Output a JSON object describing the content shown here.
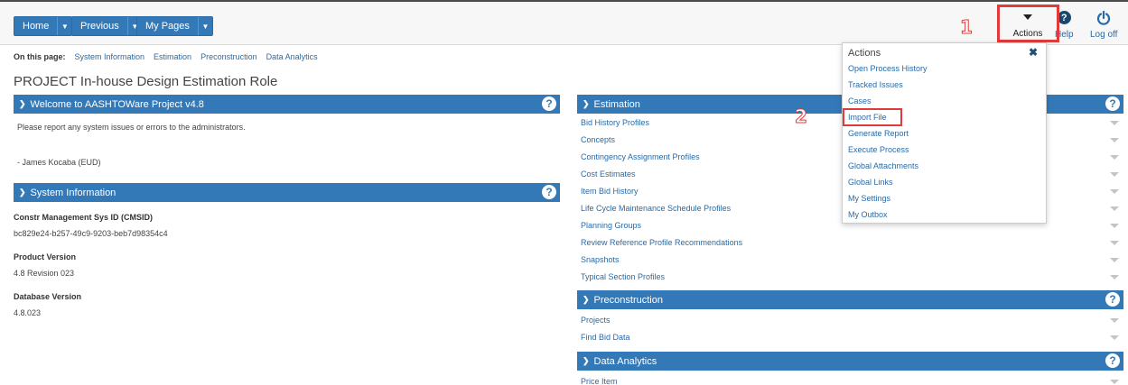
{
  "nav": {
    "home": "Home",
    "previous": "Previous",
    "my_pages": "My Pages"
  },
  "toolbar": {
    "actions": "Actions",
    "help": "Help",
    "logoff": "Log off"
  },
  "steps": {
    "one": "1",
    "two": "2"
  },
  "on_this_page": {
    "lead": "On this page:",
    "links": [
      "System Information",
      "Estimation",
      "Preconstruction",
      "Data Analytics"
    ]
  },
  "page_title": "PROJECT In-house Design Estimation Role",
  "welcome": {
    "title": "Welcome to AASHTOWare Project v4.8",
    "message": "Please report any system issues or errors to the administrators.",
    "signature": "- James Kocaba (EUD)"
  },
  "system_info": {
    "title": "System Information",
    "cmsid_label": "Constr Management Sys ID (CMSID)",
    "cmsid_value": "bc829e24-b257-49c9-9203-beb7d98354c4",
    "product_label": "Product Version",
    "product_value": "4.8 Revision 023",
    "database_label": "Database Version",
    "database_value": "4.8.023"
  },
  "estimation": {
    "title": "Estimation",
    "items": [
      "Bid History Profiles",
      "Concepts",
      "Contingency Assignment Profiles",
      "Cost Estimates",
      "Item Bid History",
      "Life Cycle Maintenance Schedule Profiles",
      "Planning Groups",
      "Review Reference Profile Recommendations",
      "Snapshots",
      "Typical Section Profiles"
    ]
  },
  "preconstruction": {
    "title": "Preconstruction",
    "items": [
      "Projects",
      "Find Bid Data"
    ]
  },
  "data_analytics": {
    "title": "Data Analytics",
    "items": [
      "Price Item"
    ]
  },
  "actions_menu": {
    "title": "Actions",
    "items": [
      "Open Process History",
      "Tracked Issues",
      "Cases",
      "Import File",
      "Generate Report",
      "Execute Process",
      "Global Attachments",
      "Global Links",
      "My Settings",
      "My Outbox"
    ]
  },
  "icons": {
    "help": "question-circle-icon",
    "logoff": "power-icon",
    "close": "close-icon",
    "chevron": "chevron-down-icon"
  },
  "colors": {
    "accent": "#3479b7",
    "link": "#2a6aa6",
    "highlight": "#e03a3a"
  }
}
